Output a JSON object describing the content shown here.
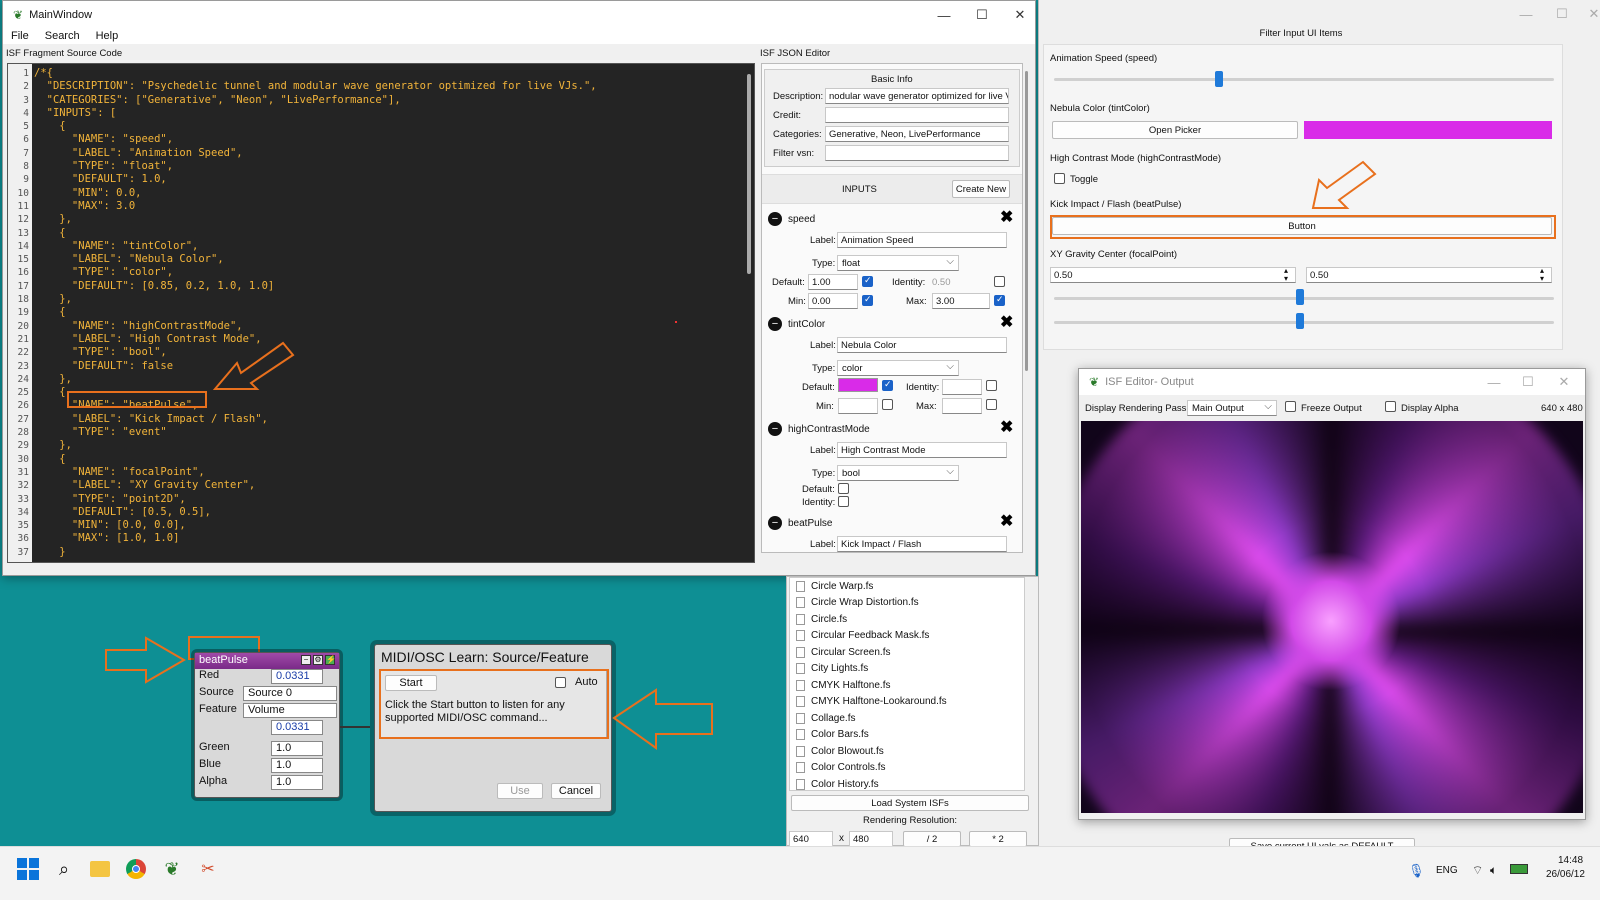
{
  "colors": {
    "teal_bg": "#0e8f94",
    "accent_orange": "#e8701d",
    "magenta": "#d92be8",
    "code_text": "#f2b43a",
    "blue": "#1f7ad9"
  },
  "main_window": {
    "title": "MainWindow",
    "menu": [
      "File",
      "Search",
      "Help"
    ],
    "source_label": "ISF Fragment Source Code",
    "json_editor_label": "ISF JSON Editor",
    "line_numbers": [
      "1",
      "2",
      "3",
      "4",
      "5",
      "6",
      "7",
      "8",
      "9",
      "10",
      "11",
      "12",
      "13",
      "14",
      "15",
      "16",
      "17",
      "18",
      "19",
      "20",
      "21",
      "22",
      "23",
      "24",
      "25",
      "26",
      "27",
      "28",
      "29",
      "30",
      "31",
      "32",
      "33",
      "34",
      "35",
      "36",
      "37"
    ],
    "code_lines": [
      "/*{",
      "  \"DESCRIPTION\": \"Psychedelic tunnel and modular wave generator optimized for live VJs.\",",
      "  \"CATEGORIES\": [\"Generative\", \"Neon\", \"LivePerformance\"],",
      "  \"INPUTS\": [",
      "    {",
      "      \"NAME\": \"speed\",",
      "      \"LABEL\": \"Animation Speed\",",
      "      \"TYPE\": \"float\",",
      "      \"DEFAULT\": 1.0,",
      "      \"MIN\": 0.0,",
      "      \"MAX\": 3.0",
      "    },",
      "    {",
      "      \"NAME\": \"tintColor\",",
      "      \"LABEL\": \"Nebula Color\",",
      "      \"TYPE\": \"color\",",
      "      \"DEFAULT\": [0.85, 0.2, 1.0, 1.0]",
      "    },",
      "    {",
      "      \"NAME\": \"highContrastMode\",",
      "      \"LABEL\": \"High Contrast Mode\",",
      "      \"TYPE\": \"bool\",",
      "      \"DEFAULT\": false",
      "    },",
      "    {",
      "      \"NAME\": \"beatPulse\",",
      "      \"LABEL\": \"Kick Impact / Flash\",",
      "      \"TYPE\": \"event\"",
      "    },",
      "    {",
      "      \"NAME\": \"focalPoint\",",
      "      \"LABEL\": \"XY Gravity Center\",",
      "      \"TYPE\": \"point2D\",",
      "      \"DEFAULT\": [0.5, 0.5],",
      "      \"MIN\": [0.0, 0.0],",
      "      \"MAX\": [1.0, 1.0]",
      "    }"
    ]
  },
  "json_editor": {
    "basic_info": "Basic Info",
    "description_label": "Description:",
    "description_value": "nodular wave generator optimized for live VJs.",
    "credit_label": "Credit:",
    "credit_value": "",
    "categories_label": "Categories:",
    "categories_value": "Generative, Neon, LivePerformance",
    "filter_vsn_label": "Filter vsn:",
    "filter_vsn_value": "",
    "inputs_label": "INPUTS",
    "create_new": "Create New",
    "speed": {
      "name": "speed",
      "label_caption": "Label:",
      "label": "Animation Speed",
      "type_caption": "Type:",
      "type": "float",
      "default_caption": "Default:",
      "default": "1.00",
      "identity_caption": "Identity:",
      "identity": "0.50",
      "min_caption": "Min:",
      "min": "0.00",
      "max_caption": "Max:",
      "max": "3.00"
    },
    "tint": {
      "name": "tintColor",
      "label": "Nebula Color",
      "type": "color"
    },
    "hc": {
      "name": "highContrastMode",
      "label": "High Contrast Mode",
      "type": "bool"
    },
    "beat": {
      "name": "beatPulse",
      "label": "Kick Impact / Flash"
    },
    "default_caption": "Default:",
    "identity_caption": "Identity:",
    "min_caption": "Min:",
    "max_caption": "Max:",
    "label_caption": "Label:",
    "type_caption": "Type:"
  },
  "file_list": {
    "items": [
      "Circle Warp.fs",
      "Circle Wrap Distortion.fs",
      "Circle.fs",
      "Circular Feedback Mask.fs",
      "Circular Screen.fs",
      "City Lights.fs",
      "CMYK Halftone.fs",
      "CMYK Halftone-Lookaround.fs",
      "Collage.fs",
      "Color Bars.fs",
      "Color Blowout.fs",
      "Color Controls.fs",
      "Color History.fs"
    ],
    "load_button": "Load System ISFs",
    "rendering_resolution": "Rendering Resolution:",
    "width": "640",
    "x": "x",
    "height": "480",
    "half": "/ 2",
    "double": "* 2"
  },
  "filter_panel": {
    "title": "Filter Input UI Items",
    "speed_label": "Animation Speed (speed)",
    "speed_value": 0.33,
    "tint_label": "Nebula Color (tintColor)",
    "open_picker": "Open Picker",
    "hc_label": "High Contrast Mode (highContrastMode)",
    "toggle": "Toggle",
    "beat_label": "Kick Impact / Flash (beatPulse)",
    "button": "Button",
    "focal_label": "XY Gravity Center (focalPoint)",
    "focal_x": "0.50",
    "focal_y": "0.50",
    "save_default": "Save current UI vals as DEFAULT"
  },
  "output_window": {
    "title": "ISF Editor- Output",
    "pass_label": "Display Rendering Pass:",
    "pass_value": "Main Output",
    "freeze": "Freeze Output",
    "alpha": "Display Alpha",
    "size": "640 x 480"
  },
  "node": {
    "title": "beatPulse",
    "red_label": "Red",
    "red_value": "0.0331",
    "source_label": "Source",
    "source_value": "Source 0",
    "feature_label": "Feature",
    "feature_value": "Volume",
    "sub_value": "0.0331",
    "green_label": "Green",
    "green_value": "1.0",
    "blue_label": "Blue",
    "blue_value": "1.0",
    "alpha_label": "Alpha",
    "alpha_value": "1.0"
  },
  "midi_dialog": {
    "title": "MIDI/OSC Learn: Source/Feature",
    "start": "Start",
    "auto": "Auto",
    "message": "Click the Start button to listen for any supported MIDI/OSC command...",
    "use": "Use",
    "cancel": "Cancel"
  },
  "taskbar": {
    "lang": "ENG",
    "time": "14:48",
    "date": "26/06/12"
  }
}
